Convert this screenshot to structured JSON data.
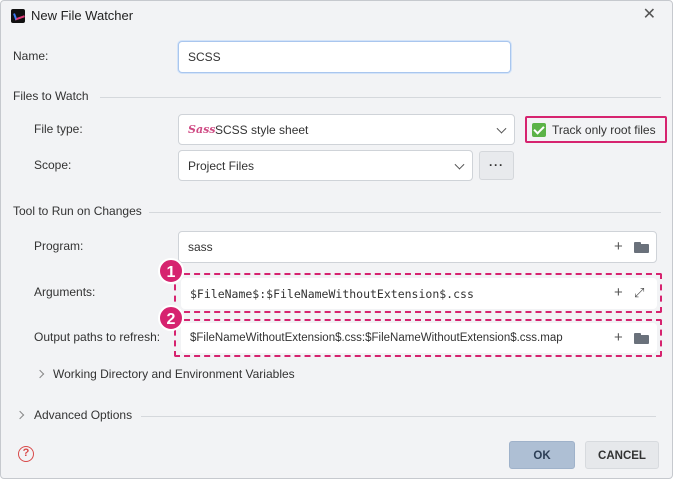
{
  "window": {
    "title": "New File Watcher"
  },
  "name": {
    "label": "Name:",
    "value": "SCSS"
  },
  "files_to_watch": {
    "section": "Files to Watch",
    "file_type": {
      "label": "File type:",
      "value": "SCSS style sheet"
    },
    "track_root": {
      "label": "Track only root files",
      "checked": true
    },
    "scope": {
      "label": "Scope:",
      "value": "Project Files",
      "browse_label": "···"
    }
  },
  "tool": {
    "section": "Tool to Run on Changes",
    "program": {
      "label": "Program:",
      "value": "sass"
    },
    "arguments": {
      "label": "Arguments:",
      "value": "$FileName$:$FileNameWithoutExtension$.css"
    },
    "output": {
      "label": "Output paths to refresh:",
      "value": "$FileNameWithoutExtension$.css:$FileNameWithoutExtension$.css.map"
    },
    "working_dir": {
      "label": "Working Directory and Environment Variables"
    }
  },
  "advanced": {
    "label": "Advanced Options"
  },
  "callouts": {
    "one": "1",
    "two": "2"
  },
  "buttons": {
    "ok": "OK",
    "cancel": "CANCEL",
    "help": "?"
  },
  "icons": {
    "add": "+",
    "close": "✕",
    "expand": "⤢",
    "sass_logo": "Sass"
  },
  "colors": {
    "highlight": "#d6236f",
    "checkbox": "#5bb347",
    "ok_button": "#aebfd4"
  }
}
